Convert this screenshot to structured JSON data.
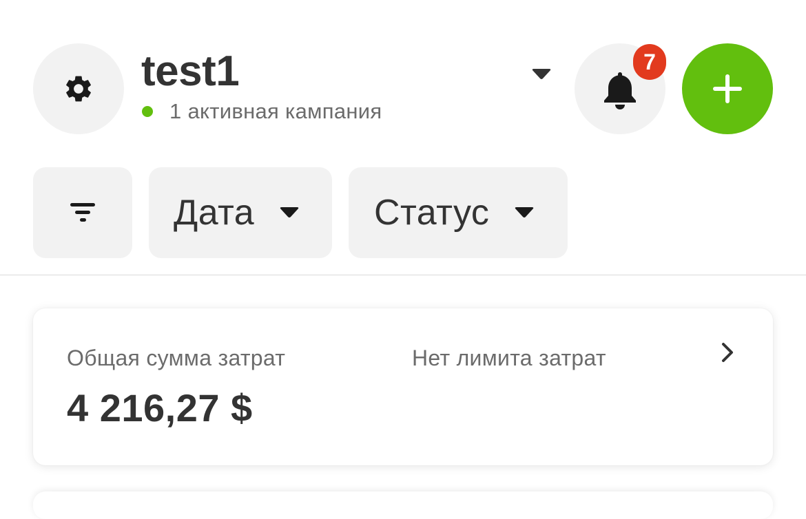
{
  "header": {
    "account_name": "test1",
    "account_status": "1 активная кампания",
    "notifications_count": "7",
    "status_color": "#62bf0e",
    "add_button_color": "#62bf0e",
    "badge_color": "#e23a1e",
    "icons": {
      "settings": "gear-icon",
      "account_dropdown": "caret-down-icon",
      "notifications": "bell-icon",
      "add": "plus-icon"
    }
  },
  "filters": {
    "filter_icon": "filter-icon",
    "date_label": "Дата",
    "status_label": "Статус"
  },
  "summary_card": {
    "spend_label": "Общая сумма затрат",
    "spend_value": "4 216,27 $",
    "limit_label": "Нет лимита затрат",
    "chevron_icon": "chevron-right-icon"
  }
}
